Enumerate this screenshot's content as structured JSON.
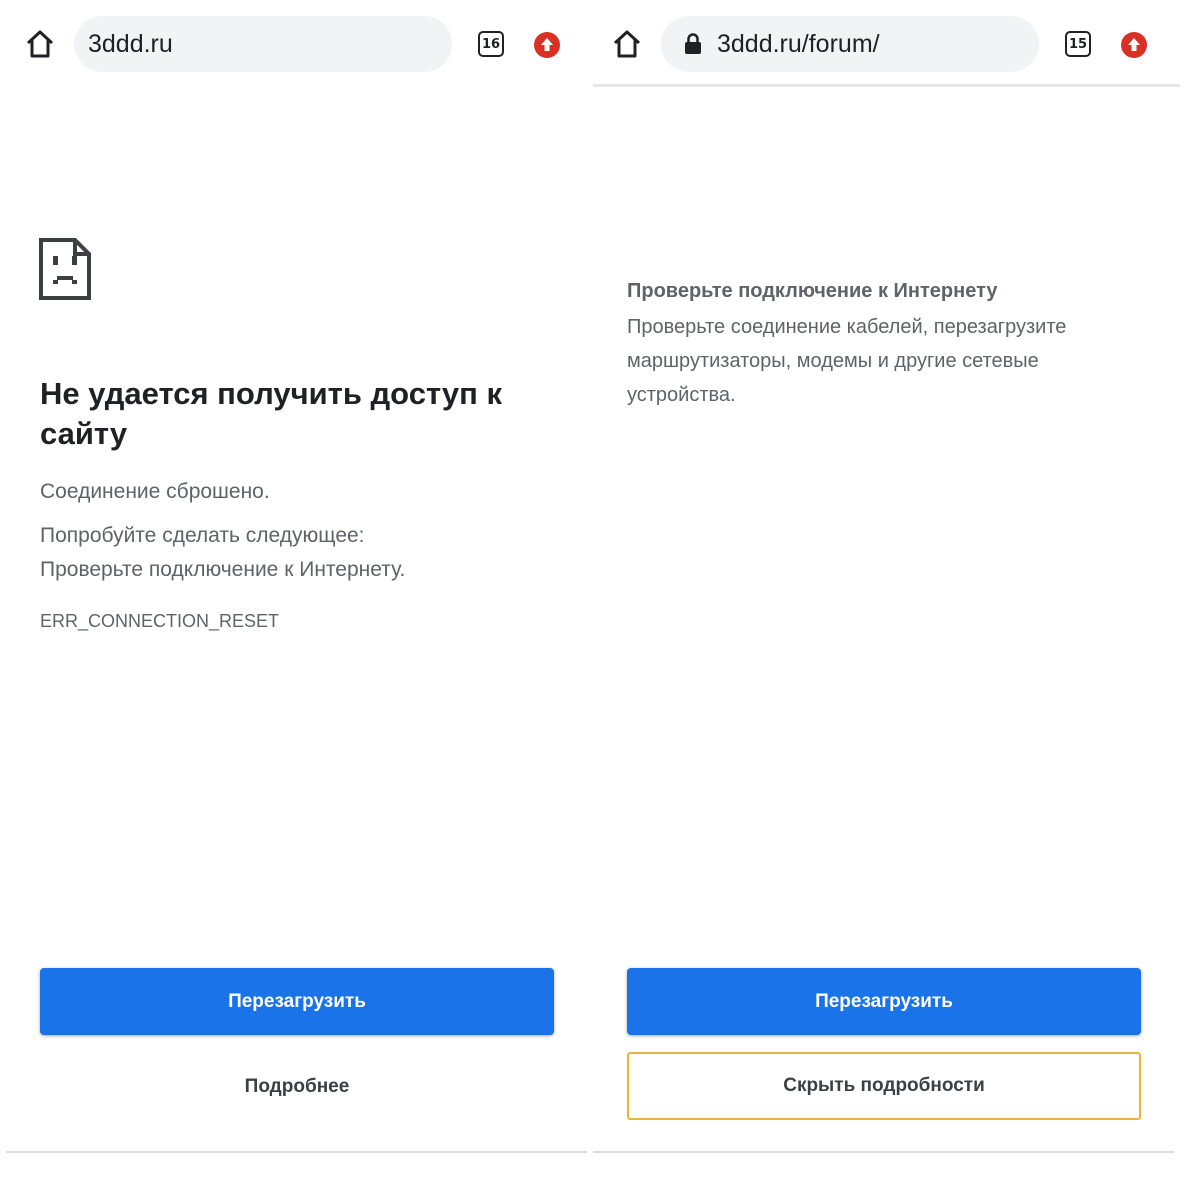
{
  "left": {
    "url": "3ddd.ru",
    "tab_count": "16",
    "icons": {
      "home": "home-icon",
      "tabs": "tab-switcher-icon",
      "update": "update-arrow-icon",
      "error": "sad-page-icon"
    },
    "heading": "Не удается получить доступ к сайту",
    "reason": "Соединение сброшено.",
    "try_label": "Попробуйте сделать следующее:",
    "suggestion": "Проверьте подключение к Интернету.",
    "error_code": "ERR_CONNECTION_RESET",
    "reload_label": "Перезагрузить",
    "details_label": "Подробнее"
  },
  "right": {
    "url": "3ddd.ru/forum/",
    "tab_count": "15",
    "icons": {
      "home": "home-icon",
      "lock": "lock-icon",
      "tabs": "tab-switcher-icon",
      "update": "update-arrow-icon"
    },
    "details_title": "Проверьте подключение к Интернету",
    "details_body": "Проверьте соединение кабелей, перезагрузите маршрутизаторы, модемы и другие сетевые устройства.",
    "reload_label": "Перезагрузить",
    "hide_details_label": "Скрыть подробности"
  },
  "colors": {
    "accent_blue": "#1a73e8",
    "update_red": "#d93025",
    "focus_outline": "#e8b53a",
    "secondary_text": "#5f6368"
  }
}
